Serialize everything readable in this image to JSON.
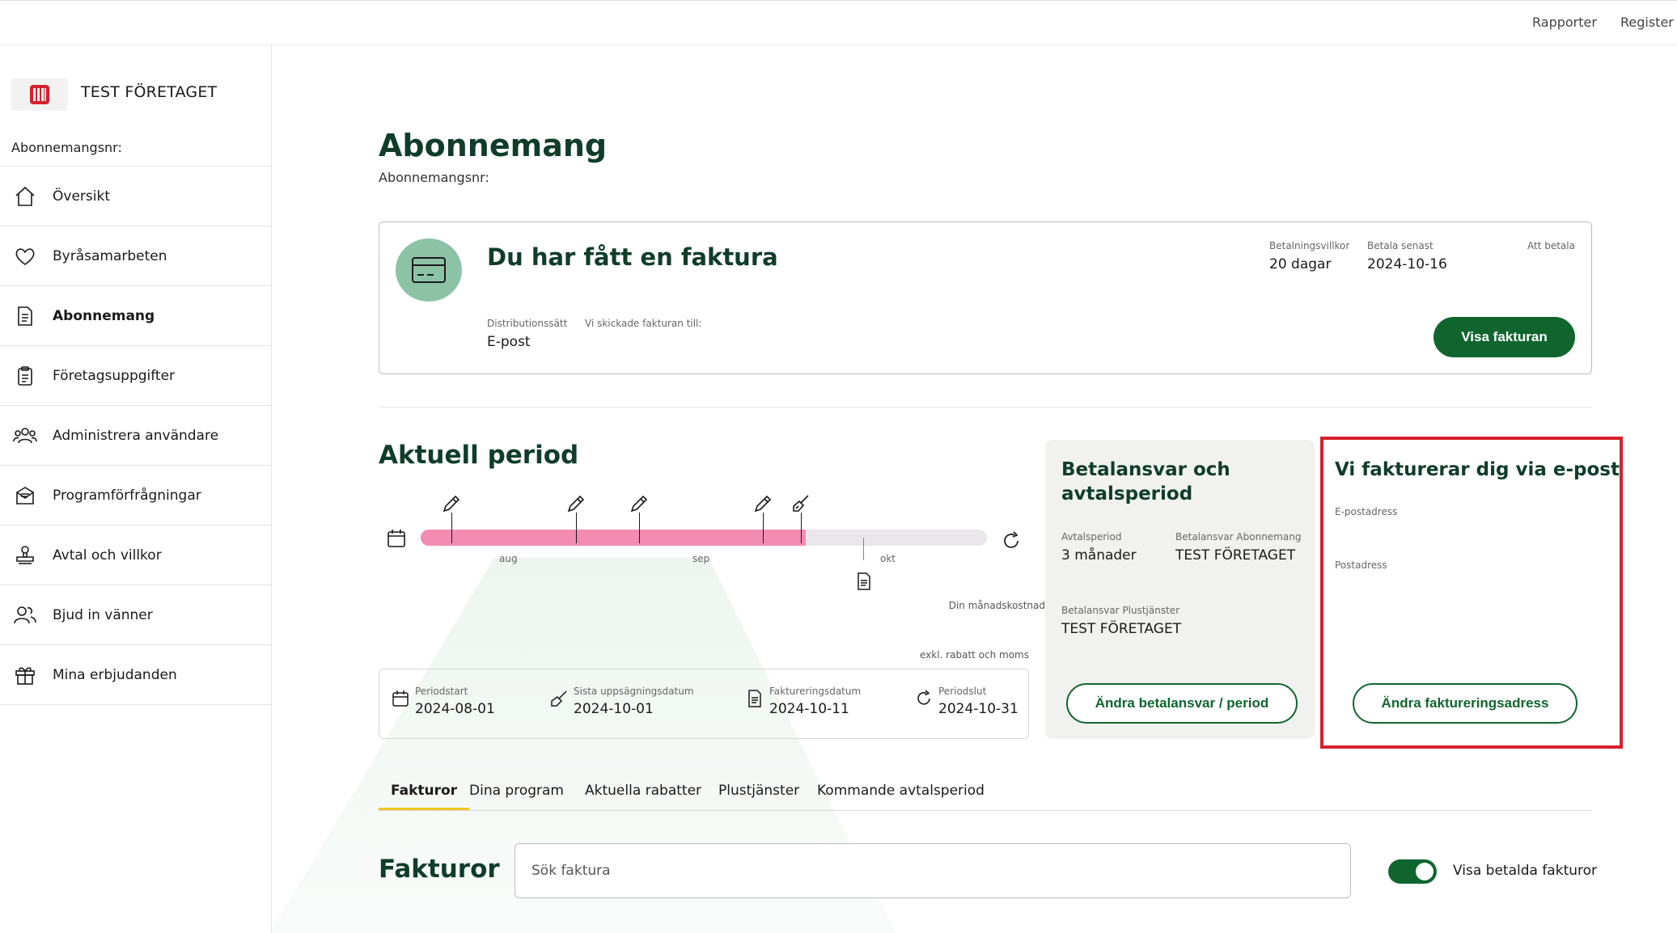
{
  "topbar": {
    "links": [
      "Rapporter",
      "Register"
    ]
  },
  "sidebar": {
    "company_name": "TEST FÖRETAGET",
    "subscription_label": "Abonnemangsnr:",
    "items": [
      {
        "label": "Översikt",
        "icon": "home-icon",
        "active": false
      },
      {
        "label": "Byråsamarbeten",
        "icon": "heart-icon",
        "active": false
      },
      {
        "label": "Abonnemang",
        "icon": "document-icon",
        "active": true
      },
      {
        "label": "Företagsuppgifter",
        "icon": "clipboard-icon",
        "active": false
      },
      {
        "label": "Administrera användare",
        "icon": "users-icon",
        "active": false
      },
      {
        "label": "Programförfrågningar",
        "icon": "inbox-icon",
        "active": false
      },
      {
        "label": "Avtal och villkor",
        "icon": "stamp-icon",
        "active": false
      },
      {
        "label": "Bjud in vänner",
        "icon": "people-icon",
        "active": false
      },
      {
        "label": "Mina erbjudanden",
        "icon": "gift-icon",
        "active": false
      }
    ]
  },
  "main": {
    "title": "Abonnemang",
    "subtitle": "Abonnemangsnr:"
  },
  "invoice_card": {
    "title": "Du har fått en faktura",
    "payment_terms_label": "Betalningsvillkor",
    "payment_terms_value": "20 dagar",
    "due_label": "Betala senast",
    "due_value": "2024-10-16",
    "to_pay_label": "Att betala",
    "distribution_label": "Distributionssätt",
    "distribution_value": "E-post",
    "sent_to_label": "Vi skickade fakturan till:",
    "button_label": "Visa fakturan"
  },
  "period": {
    "title": "Aktuell period",
    "progress": 0.68,
    "months": [
      "aug",
      "sep",
      "okt"
    ],
    "monthly_cost_label": "Din månadskostnad",
    "excl_label": "exkl. rabatt och moms",
    "dates": [
      {
        "label": "Periodstart",
        "value": "2024-08-01",
        "icon": "calendar-icon"
      },
      {
        "label": "Sista uppsägningsdatum",
        "value": "2024-10-01",
        "icon": "broom-icon"
      },
      {
        "label": "Faktureringsdatum",
        "value": "2024-10-11",
        "icon": "invoice-icon"
      },
      {
        "label": "Periodslut",
        "value": "2024-10-31",
        "icon": "refresh-icon"
      }
    ]
  },
  "responsibility": {
    "title": "Betalansvar och avtalsperiod",
    "contract_period_label": "Avtalsperiod",
    "contract_period_value": "3 månader",
    "payer_sub_label": "Betalansvar Abonnemang",
    "payer_sub_value": "TEST FÖRETAGET",
    "payer_plus_label": "Betalansvar Plustjänster",
    "payer_plus_value": "TEST FÖRETAGET",
    "button_label": "Ändra betalansvar / period"
  },
  "email_billing": {
    "title": "Vi fakturerar dig via e-post",
    "email_label": "E-postadress",
    "postal_label": "Postadress",
    "button_label": "Ändra faktureringsadress",
    "highlight_color": "#d6212f"
  },
  "tabs": [
    {
      "label": "Fakturor",
      "active": true
    },
    {
      "label": "Dina program",
      "active": false
    },
    {
      "label": "Aktuella rabatter",
      "active": false
    },
    {
      "label": "Plustjänster",
      "active": false
    },
    {
      "label": "Kommande avtalsperiod",
      "active": false
    }
  ],
  "invoices": {
    "title": "Fakturor",
    "search_placeholder": "Sök faktura",
    "toggle_label": "Visa betalda fakturor",
    "toggle_on": true
  },
  "colors": {
    "brand_green": "#10652f",
    "heading_green": "#0f3d2a",
    "progress_pink": "#f28cb1",
    "tab_accent": "#f0c420"
  }
}
